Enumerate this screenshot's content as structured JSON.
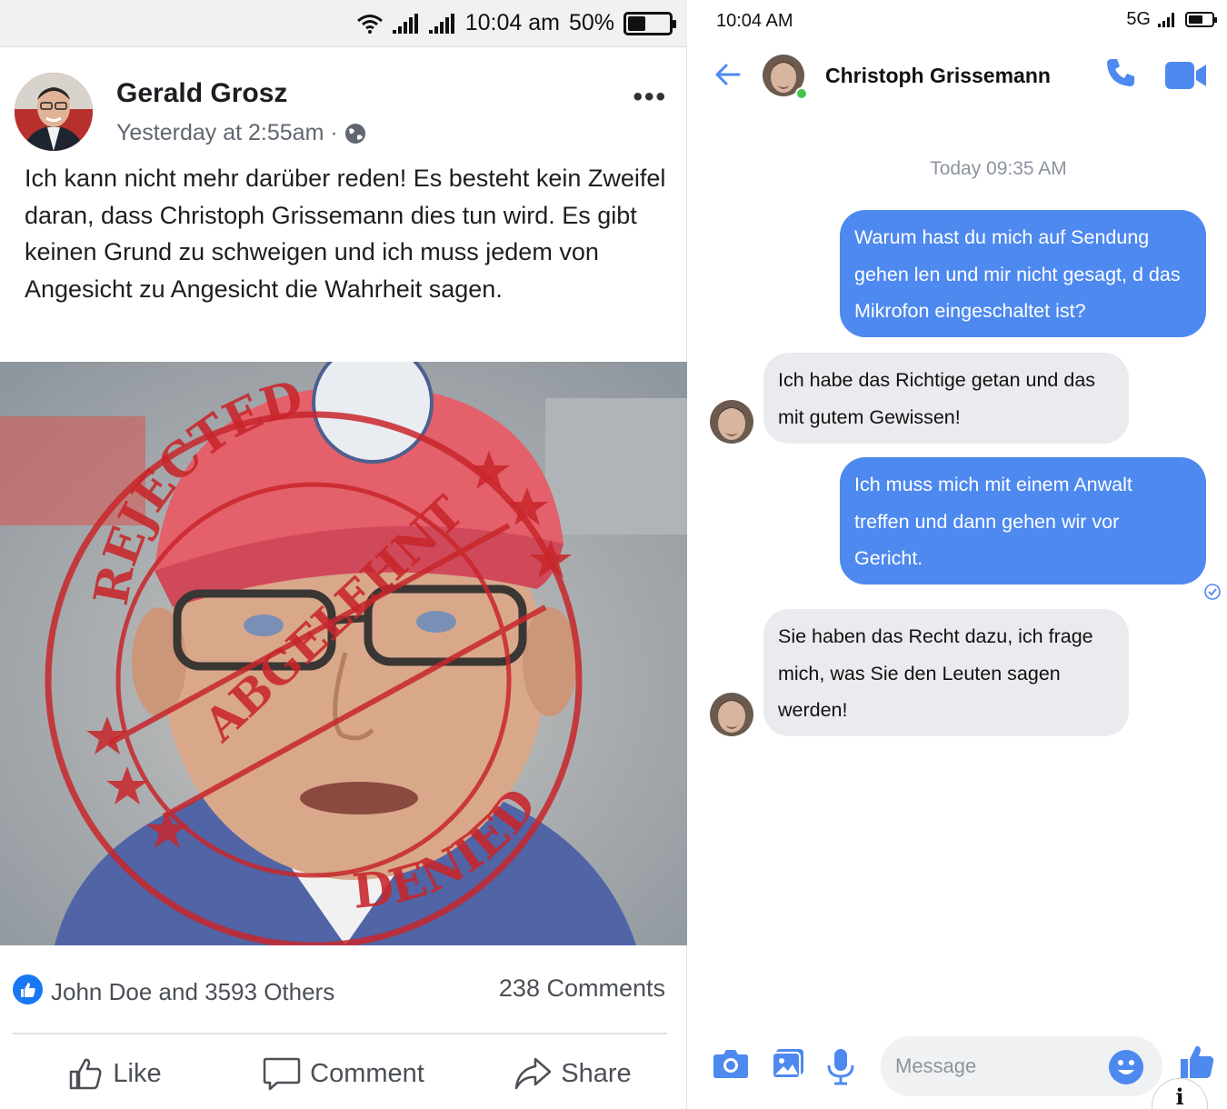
{
  "left_status": {
    "time": "10:04 am",
    "battery": "50%"
  },
  "post": {
    "author": "Gerald Grosz",
    "meta": "Yesterday at 2:55am ·",
    "more": "•••",
    "text": "Ich kann nicht mehr darüber reden! Es besteht kein Zweifel daran, dass Christoph Grissemann dies tun wird. Es gibt keinen Grund zu schweigen und ich muss jedem von Angesicht zu Angesicht die Wahrheit sagen.",
    "stamp": {
      "arc_top": "REJECTED",
      "diagonal": "ABGELEHNT",
      "arc_bottom": "DENIED",
      "color": "#c8262b"
    },
    "reactions_text": "John Doe and 3593 Others",
    "comments": "238 Comments",
    "actions": {
      "like": "Like",
      "comment": "Comment",
      "share": "Share"
    }
  },
  "right_status": {
    "time": "10:04 AM",
    "network": "5G"
  },
  "chat": {
    "contact_name": "Christoph Grissemann",
    "timestamp": "Today 09:35 AM",
    "messages": [
      {
        "direction": "outgoing",
        "text": "Warum hast du mich auf Sendung gehen len und mir nicht gesagt, d das Mikrofon eingeschaltet ist?"
      },
      {
        "direction": "incoming",
        "text": "Ich habe das Richtige getan und das mit gutem Gewissen!"
      },
      {
        "direction": "outgoing",
        "text": "Ich muss mich mit einem Anwalt treffen und dann gehen wir vor Gericht."
      },
      {
        "direction": "incoming",
        "text": "Sie haben das Recht dazu, ich frage mich, was Sie den Leuten sagen werden!"
      }
    ],
    "composer": {
      "placeholder": "Message"
    },
    "accent_color": "#4e89ef",
    "info_label": "i"
  }
}
